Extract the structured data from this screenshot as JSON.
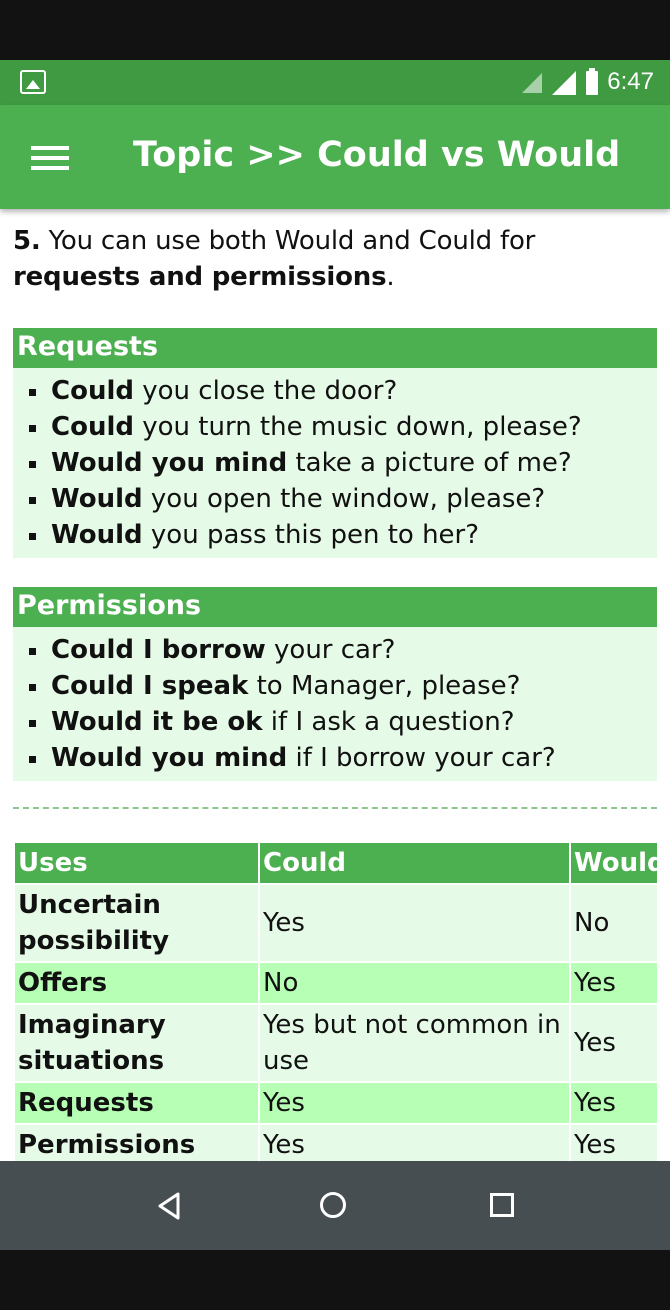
{
  "status_bar": {
    "time": "6:47",
    "icons": [
      "image-icon",
      "signal-outline-icon",
      "signal-icon",
      "battery-icon"
    ]
  },
  "app_bar": {
    "title": "Topic >> Could vs Would",
    "menu_icon": "menu-icon"
  },
  "content": {
    "intro": {
      "number": "5.",
      "text": " You can use both Would and Could for ",
      "bold": "requests and permissions",
      "end": "."
    },
    "sections": [
      {
        "header": "Requests",
        "items": [
          {
            "bold": "Could",
            "text": " you close the door?"
          },
          {
            "bold": "Could",
            "text": " you turn the music down, please?"
          },
          {
            "bold": "Would you mind",
            "text": " take a picture of me?"
          },
          {
            "bold": "Would",
            "text": " you open the window, please?"
          },
          {
            "bold": "Would",
            "text": " you pass this pen to her?"
          }
        ]
      },
      {
        "header": "Permissions",
        "items": [
          {
            "bold": "Could I borrow",
            "text": " your car?"
          },
          {
            "bold": "Could I speak",
            "text": " to Manager, please?"
          },
          {
            "bold": "Would it be ok",
            "text": " if I ask a question?"
          },
          {
            "bold": "Would you mind",
            "text": " if I borrow your car?"
          }
        ]
      }
    ],
    "table": {
      "headers": [
        "Uses",
        "Could",
        "Would"
      ],
      "rows": [
        [
          "Uncertain possibility",
          "Yes",
          "No"
        ],
        [
          "Offers",
          "No",
          "Yes"
        ],
        [
          "Imaginary situations",
          "Yes but not common in use",
          "Yes"
        ],
        [
          "Requests",
          "Yes",
          "Yes"
        ],
        [
          "Permissions",
          "Yes",
          "Yes"
        ]
      ]
    }
  },
  "nav_bar": {
    "buttons": [
      "back-icon",
      "home-icon",
      "recent-apps-icon"
    ]
  },
  "colors": {
    "status_bar": "#3f9a42",
    "app_bar": "#4caf50",
    "light_green": "#e6fbe7",
    "bright_green": "#b7ffb5",
    "nav_bar": "#474e51"
  }
}
